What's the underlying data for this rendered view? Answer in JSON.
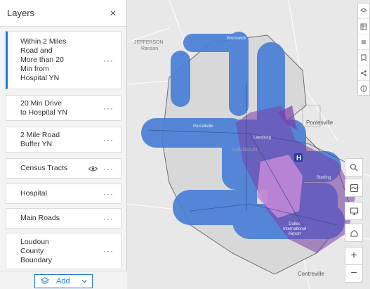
{
  "panel": {
    "title": "Layers",
    "close_icon": "close-icon",
    "layers": [
      {
        "label": "Within 2 Miles\nRoad and\nMore than 20\nMin from\nHospital YN",
        "active": true
      },
      {
        "label": "20 Min Drive\nto Hospital YN",
        "active": false
      },
      {
        "label": "2 Mile Road\nBuffer YN",
        "active": false
      },
      {
        "label": "Census Tracts",
        "active": false,
        "hidden_icon": "eye-icon"
      },
      {
        "label": "Hospital",
        "active": false
      },
      {
        "label": "Main Roads",
        "active": false
      },
      {
        "label": "Loudoun\nCounty\nBoundary",
        "active": false
      }
    ],
    "more_glyph": "···",
    "add_label": "Add"
  },
  "map": {
    "labels": {
      "jefferson": "JEFFERSON",
      "ranson": "Ranson",
      "brunswick": "Brunswick",
      "purcellville": "Purcellville",
      "loudoun": "LOUDOUN",
      "leesburg": "Leesburg",
      "poolesville": "Poolesville",
      "sterling": "Sterling",
      "dulles": "Dulles\nInternational\nAirport",
      "centreville": "Centreville"
    },
    "colors": {
      "buffer": "#4a7fd6",
      "drive": "#7a3fa8",
      "overlap": "#b87ad0",
      "accent": "#1f78d1"
    }
  },
  "controls": {
    "search_icon": "search-icon",
    "layers_icon": "basemap-icon",
    "screen_icon": "monitor-icon",
    "home_icon": "home-icon",
    "zoom_in": "+",
    "zoom_out": "−"
  }
}
